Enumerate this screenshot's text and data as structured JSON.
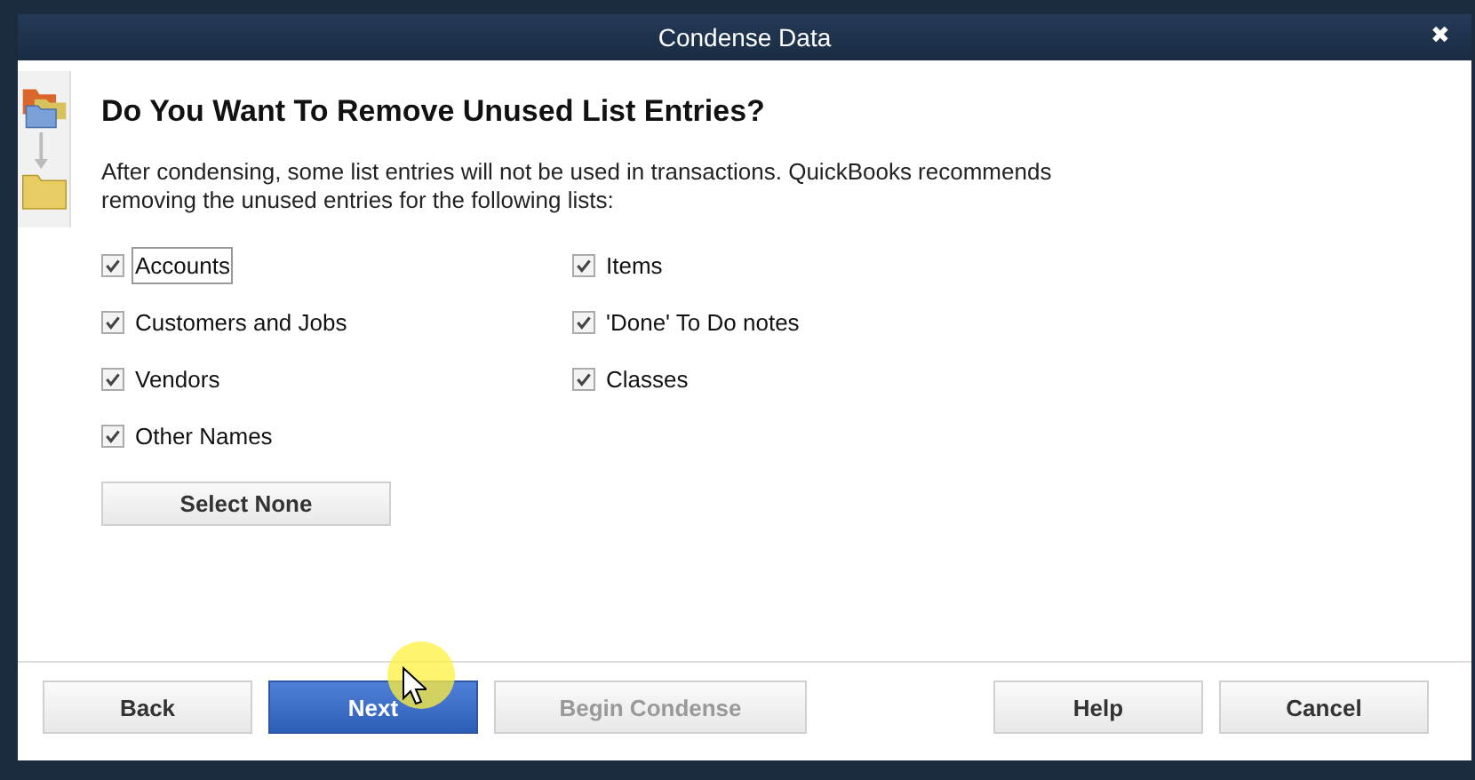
{
  "window": {
    "title": "Condense Data",
    "close": "✖"
  },
  "heading": "Do You Want To Remove Unused List Entries?",
  "description": "After condensing, some list entries will not be used in transactions. QuickBooks recommends removing the unused entries for the following lists:",
  "list_columns": [
    [
      {
        "label": "Accounts",
        "checked": true,
        "focused": true
      },
      {
        "label": "Customers and Jobs",
        "checked": true,
        "focused": false
      },
      {
        "label": "Vendors",
        "checked": true,
        "focused": false
      },
      {
        "label": "Other Names",
        "checked": true,
        "focused": false
      }
    ],
    [
      {
        "label": "Items",
        "checked": true,
        "focused": false
      },
      {
        "label": "'Done' To Do notes",
        "checked": true,
        "focused": false
      },
      {
        "label": "Classes",
        "checked": true,
        "focused": false
      }
    ]
  ],
  "select_none": "Select None",
  "buttons": [
    {
      "label": "Back",
      "kind": "normal",
      "disabled": false
    },
    {
      "label": "Next",
      "kind": "primary",
      "disabled": false
    },
    {
      "label": "Begin Condense",
      "kind": "normal",
      "disabled": true
    },
    {
      "label": "Help",
      "kind": "normal",
      "disabled": false
    },
    {
      "label": "Cancel",
      "kind": "normal",
      "disabled": false
    }
  ]
}
